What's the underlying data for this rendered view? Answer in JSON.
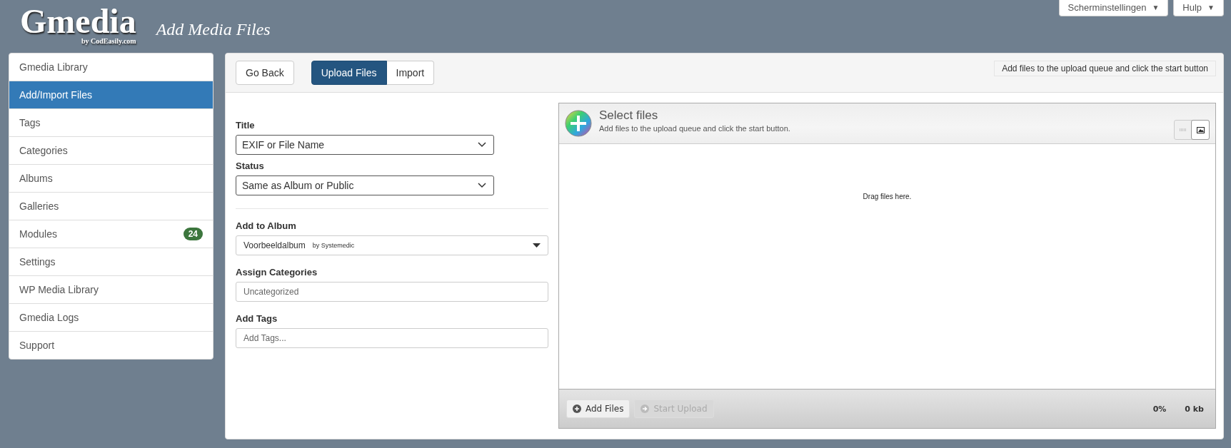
{
  "header": {
    "logo": "Gmedia",
    "logo_byline": "by CodEasily.com",
    "page_title": "Add Media Files",
    "top_buttons": [
      {
        "label": "Scherminstellingen",
        "caret": "▼"
      },
      {
        "label": "Hulp",
        "caret": "▼"
      }
    ]
  },
  "sidebar": {
    "items": [
      {
        "label": "Gmedia Library",
        "selected": false
      },
      {
        "label": "Add/Import Files",
        "selected": true
      },
      {
        "label": "Tags",
        "selected": false
      },
      {
        "label": "Categories",
        "selected": false
      },
      {
        "label": "Albums",
        "selected": false
      },
      {
        "label": "Galleries",
        "selected": false
      },
      {
        "label": "Modules",
        "selected": false,
        "badge": "24"
      },
      {
        "label": "Settings",
        "selected": false
      },
      {
        "label": "WP Media Library",
        "selected": false
      },
      {
        "label": "Gmedia Logs",
        "selected": false
      },
      {
        "label": "Support",
        "selected": false
      }
    ]
  },
  "toolbar": {
    "back_button": "Go Back",
    "tabs": [
      {
        "label": "Upload Files",
        "selected": true
      },
      {
        "label": "Import",
        "selected": false
      }
    ],
    "hint": "Add files to the upload queue and click the start button"
  },
  "form": {
    "fields": [
      {
        "kind": "select",
        "label": "Title",
        "value": "EXIF or File Name"
      },
      {
        "kind": "select",
        "label": "Status",
        "value": "Same as Album or Public"
      },
      {
        "kind": "divider"
      },
      {
        "kind": "combo",
        "label": "Add to Album",
        "value": "Voorbeeldalbum",
        "note": "by Systemedic"
      },
      {
        "kind": "input",
        "label": "Assign Categories",
        "placeholder": "Uncategorized"
      },
      {
        "kind": "input",
        "label": "Add Tags",
        "placeholder": "Add Tags..."
      }
    ]
  },
  "uploader": {
    "title": "Select files",
    "subtitle": "Add files to the upload queue and click the start button.",
    "view_modes": [
      {
        "kind": "list",
        "selected": false
      },
      {
        "kind": "thumbs",
        "selected": true
      }
    ],
    "drop_text": "Drag files here.",
    "buttons": [
      {
        "label": "Add Files",
        "disabled": false
      },
      {
        "label": "Start Upload",
        "disabled": true
      }
    ],
    "percent": "0%",
    "size": "0 kb"
  }
}
